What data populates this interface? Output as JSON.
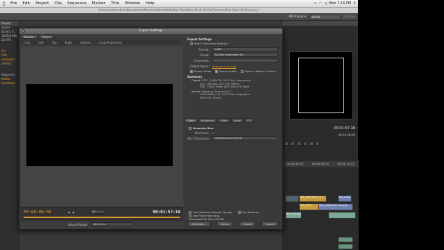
{
  "menubar": {
    "items": [
      "File",
      "Edit",
      "Project",
      "Clip",
      "Sequence",
      "Marker",
      "Title",
      "Window",
      "Help"
    ],
    "clock": "Mon 7:15 PM"
  },
  "app": {
    "path": "/Users/rachelcoburn/Documents/Movies/Adobe/Media/Ravi Desh/Ravi Desh 60 Rd Premiere/Ravi Desh 60 Rd.prproj *",
    "workspace_label": "Workspace:",
    "workspace_value": "Media",
    "cs_live": "CS Live",
    "project_tab": "Project",
    "left_rows": [
      "sjones",
      "01001, 5...",
      "1920x1080...",
      "23.976",
      "GO",
      "FOX",
      "Uploaded",
      "GHOST",
      "Sequence",
      "Media",
      "Uploaded"
    ],
    "right_tc": "00:01:57:16",
    "right_tc2": "00:00:28:09",
    "ruler": [
      "00:00:44:22",
      "00:00:59:22",
      "00:01:14:23"
    ],
    "clips": [
      "MVI_0083.MOV [V]",
      "MVI_0084.MOV",
      "MVI_0083.MOV Opacity...",
      "MVI_0083",
      "MVI_0083.MOV",
      "MVI_0087"
    ]
  },
  "dialog": {
    "title": "Export Settings",
    "source_tabs": [
      "Source",
      "Output"
    ],
    "source_toolbar": [
      "Crop",
      "Left",
      "Top",
      "Right",
      "Bottom",
      "Crop Proportions"
    ],
    "tc_current": "00:00:00:00",
    "tc_duration": "00:01:57:18",
    "fit": "Fit",
    "source_range_label": "Source Range:",
    "source_range_value": "Work Area",
    "export_settings_heading": "Export Settings",
    "match_sequence": "Match Sequence Settings",
    "format_label": "Format:",
    "format_value": "H.264",
    "preset_label": "Preset:",
    "preset_value": "YouTube Widescreen HD",
    "comments_label": "Comments:",
    "output_name_label": "Output Name:",
    "output_name_value": "Sequence 01.mp4",
    "export_video": "Export Video",
    "export_audio": "Export Audio",
    "open_device": "Open in Device Central",
    "summary_heading": "Summary",
    "summary_output_label": "Output:",
    "summary_output": [
      "NTSC, 1280x720, 29.97 fps, Progressive",
      "AAC, 128 kbps, 44.1 kHz, Stereo",
      "VBR, 1 Pass, Target 8.00, Max 8.00 Mbps"
    ],
    "summary_source_label": "Source:",
    "summary_source": [
      "Sequence, Sequence 01",
      "1920x1080 (1.0), 23.976 fps, Progressive",
      "48000 Hz, Stereo"
    ],
    "settings_tabs": [
      "Filters",
      "Multiplexer",
      "Video",
      "Audio",
      "FTP"
    ],
    "filter_name": "Gaussian Blur",
    "blurriness_label": "Blurriness:",
    "blurriness_value": "0",
    "blur_dim_label": "Blur Dimension:",
    "blur_dim_value": "Horizontal and Vertical",
    "max_render_quality": "Use Maximum Render Quality",
    "use_previews": "Use Previews",
    "use_frame_blending": "Use Frame Blending",
    "file_size_label": "Estimated File Size:",
    "file_size_value": "65 MB",
    "metadata_btn": "Metadata...",
    "queue_btn": "Queue",
    "export_btn": "Export",
    "cancel_btn": "Cancel"
  }
}
